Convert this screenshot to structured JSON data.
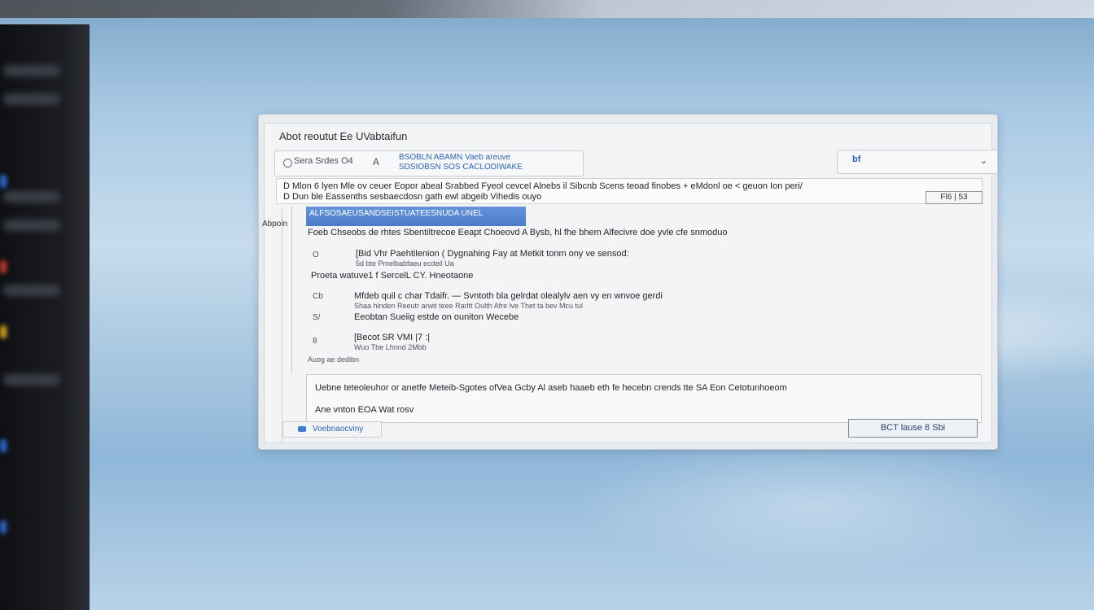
{
  "dialog": {
    "title": "Abot reoutut Ee UVabtaifun"
  },
  "search": {
    "label": "Sera Srdes",
    "value": "O4",
    "sep_glyph": "A",
    "hint_line1": "BSOBLN ABAMN Vaeb areuve",
    "hint_line2": "SDSIOBSN SOS CACLODIWAKE"
  },
  "filter": {
    "value": "bf",
    "chevron": "⌄"
  },
  "banner": {
    "line1": "D   Mlon 6 lyen  Mle ov ceuer  Eopor abeal Srabbed  Fyeol cevcel  Alnebs il Sibcnb  Scens teoad finobes  +  eMdonl oe < geuon  Ion peri/",
    "line2": "D   Dun ble  Eassenths sesbaecdosn  gath ewl abgeib  Vihedis ouyo",
    "ok_label": "Fl6 | 53"
  },
  "results": {
    "selected_text": "ALFSOSAEUSANDSEISTUATEESNUDA UNEL",
    "selected_label": "Abpoin",
    "rows": [
      {
        "num": "",
        "text": "Foeb  Chseobs de rhtes  Sbentiltrecoe   Eeapt  Choeovd  A  Bysb, hl fhe bhem  Alfecivre  doe  yvle cfe snmoduo",
        "sub": ""
      },
      {
        "num": "O",
        "text": "[Bid Vhr Paehtilenion  ( Dygnahing  Fay at Metkit   tonm ony ve sensod:",
        "sub": "  5d   bte  Pmelbabfaeu  ecdeil  Ua"
      },
      {
        "num": "",
        "text": "Proeta watuve1 f  SercelL  CY.   Hneotaone",
        "sub": ""
      },
      {
        "num": "Cb",
        "text": "Mfdeb quil  c char Tdaifr. — Svntoth bla gelrdat olealylv  aen  vy en  wnvoe gerdi",
        "sub": "Shaa hlnden  Reeutr  arwit teee  Rarltt   Oulth  Afre lve Thet  ta  bev  Mcu tul"
      },
      {
        "num": "S/",
        "text": "Eeobtan  Sueiig  estde  on ouniton  Wecebe",
        "sub": ""
      },
      {
        "num": "8",
        "text": "[Becot  SR  VMI |7 :|",
        "sub": "  Wuo  Tbe Lhnnd  2Mbb"
      }
    ],
    "footer_note": "Auog  ae dedibn"
  },
  "detail": {
    "line1": "Uebne teteoleuhor  or anetfe Meteib-Sgotes ofVea  Gcby  Al  aseb haaeb eth  fe hecebn  crends  tte SA  Eon   Cetotunhoeom",
    "line2": "Ane vnton  EOA  Wat rosv"
  },
  "status": {
    "label": "Voebnaocviny"
  },
  "action": {
    "label": "BCT  lause 8 Sbi"
  }
}
